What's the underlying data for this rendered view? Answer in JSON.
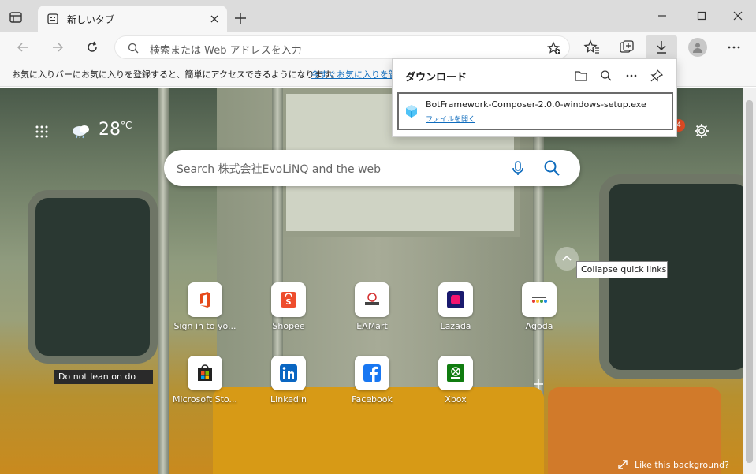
{
  "tab": {
    "title": "新しいタブ"
  },
  "address": {
    "placeholder": "検索または Web アドレスを入力"
  },
  "favorites_bar": {
    "message": "お気に入りバーにお気に入りを登録すると、簡単にアクセスできるようになります。",
    "link": "今すぐお気に入りを管理"
  },
  "weather": {
    "temp": "28",
    "unit": "°C"
  },
  "notifications": {
    "count": "4"
  },
  "search": {
    "placeholder": "Search 株式会社EvoLiNQ and the web"
  },
  "tooltip": "Collapse quick links",
  "quick_links": [
    {
      "label": "Sign in to yo..."
    },
    {
      "label": "Shopee"
    },
    {
      "label": "EAMart"
    },
    {
      "label": "Lazada"
    },
    {
      "label": "Agoda"
    },
    {
      "label": "Microsoft Sto..."
    },
    {
      "label": "Linkedin"
    },
    {
      "label": "Facebook"
    },
    {
      "label": "Xbox"
    }
  ],
  "background_sign": "Do not lean on do",
  "like_background": "Like this background?",
  "downloads": {
    "title": "ダウンロード",
    "file_name": "BotFramework-Composer-2.0.0-windows-setup.exe",
    "open_file": "ファイルを開く"
  },
  "colors": {
    "accent": "#0f6cbd",
    "badge": "#e14b24"
  }
}
